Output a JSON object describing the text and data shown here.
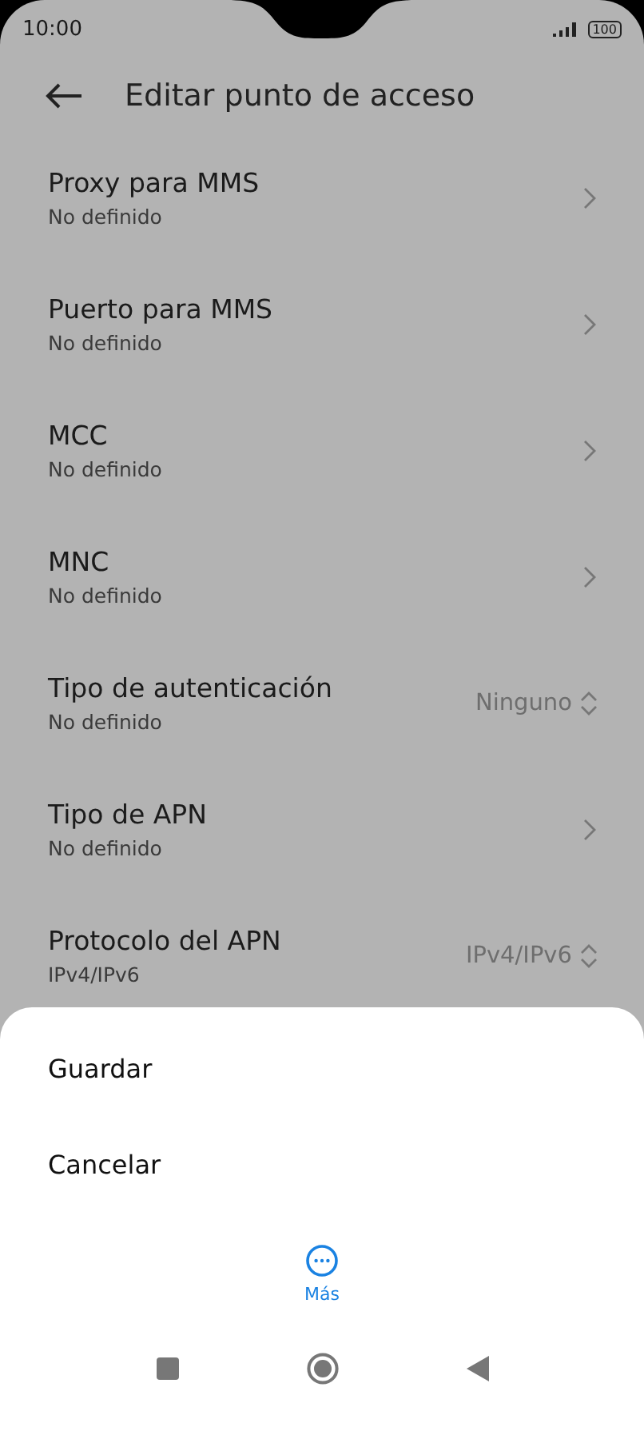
{
  "status_bar": {
    "time": "10:00",
    "battery": "100"
  },
  "header": {
    "title": "Editar punto de acceso"
  },
  "settings": [
    {
      "kind": "link",
      "title": "Proxy para MMS",
      "subtitle": "No definido"
    },
    {
      "kind": "link",
      "title": "Puerto para MMS",
      "subtitle": "No definido"
    },
    {
      "kind": "link",
      "title": "MCC",
      "subtitle": "No definido"
    },
    {
      "kind": "link",
      "title": "MNC",
      "subtitle": "No definido"
    },
    {
      "kind": "select",
      "title": "Tipo de autenticación",
      "subtitle": "No definido",
      "value": "Ninguno"
    },
    {
      "kind": "link",
      "title": "Tipo de APN",
      "subtitle": "No definido"
    },
    {
      "kind": "select",
      "title": "Protocolo del APN",
      "subtitle": "IPv4/IPv6",
      "value": "IPv4/IPv6"
    }
  ],
  "sheet": {
    "actions": [
      "Guardar",
      "Cancelar"
    ],
    "more_label": "Más"
  }
}
